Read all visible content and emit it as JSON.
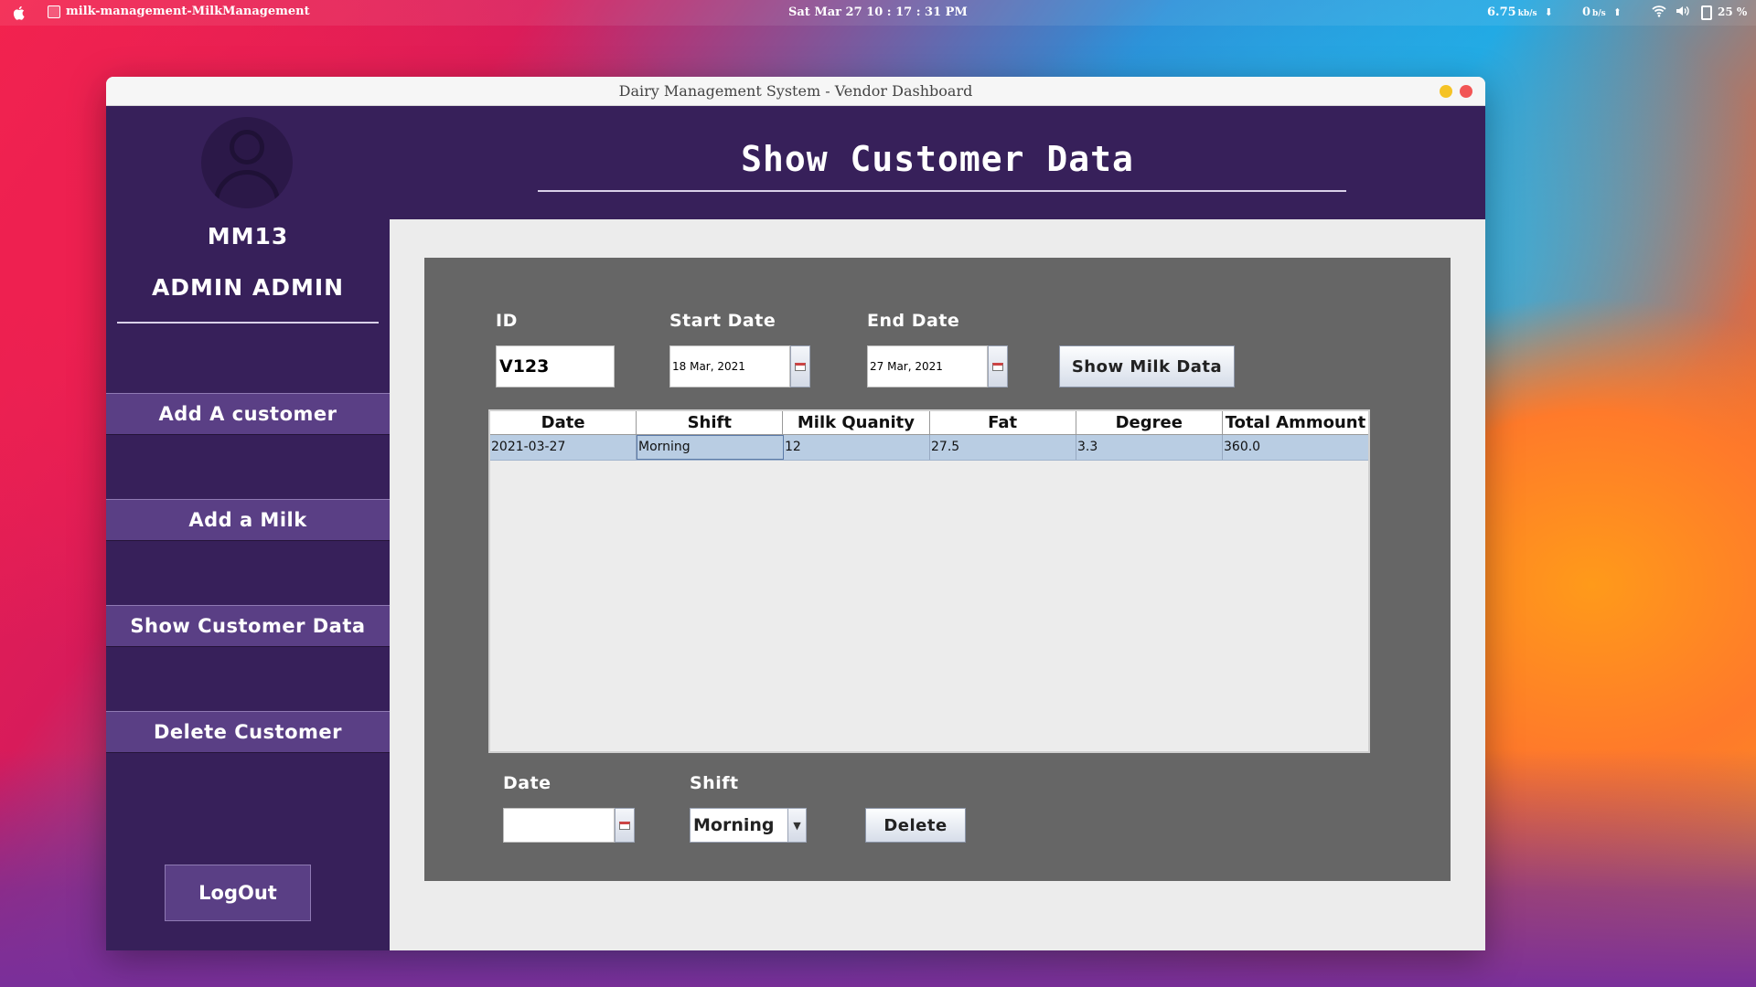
{
  "menubar": {
    "app_name": "milk-management-MilkManagement",
    "clock": "Sat Mar 27  10 : 17 : 31 PM",
    "net_down_value": "6.75",
    "net_down_unit": "kb/s",
    "net_up_value": "0",
    "net_up_unit": "b/s",
    "battery": "25 %"
  },
  "window": {
    "title": "Dairy Management System - Vendor Dashboard"
  },
  "sidebar": {
    "user_id": "MM13",
    "user_name": "ADMIN ADMIN",
    "nav": [
      {
        "label": "Add A customer"
      },
      {
        "label": "Add a Milk"
      },
      {
        "label": "Show Customer Data"
      },
      {
        "label": "Delete Customer"
      }
    ],
    "logout_label": "LogOut"
  },
  "header": {
    "title": "Show Customer Data"
  },
  "filters": {
    "id_label": "ID",
    "id_value": "V123",
    "start_label": "Start Date",
    "start_value": "18 Mar, 2021",
    "end_label": "End Date",
    "end_value": "27 Mar, 2021",
    "show_button": "Show Milk Data"
  },
  "table": {
    "columns": [
      "Date",
      "Shift",
      "Milk Quanity",
      "Fat",
      "Degree",
      "Total Ammount"
    ],
    "rows": [
      [
        "2021-03-27",
        "Morning",
        "12",
        "27.5",
        "3.3",
        "360.0"
      ]
    ]
  },
  "delete_form": {
    "date_label": "Date",
    "date_value": "",
    "shift_label": "Shift",
    "shift_value": "Morning",
    "delete_button": "Delete"
  },
  "colors": {
    "sidebar": "#37205a",
    "nav_button": "#5a3f85",
    "panel": "#666666",
    "selected_row": "#b9cde3"
  },
  "icons": [
    "apple-icon",
    "app-icon",
    "wifi-icon",
    "volume-icon",
    "battery-icon",
    "calendar-icon",
    "dropdown-arrow-icon",
    "user-avatar-icon"
  ]
}
